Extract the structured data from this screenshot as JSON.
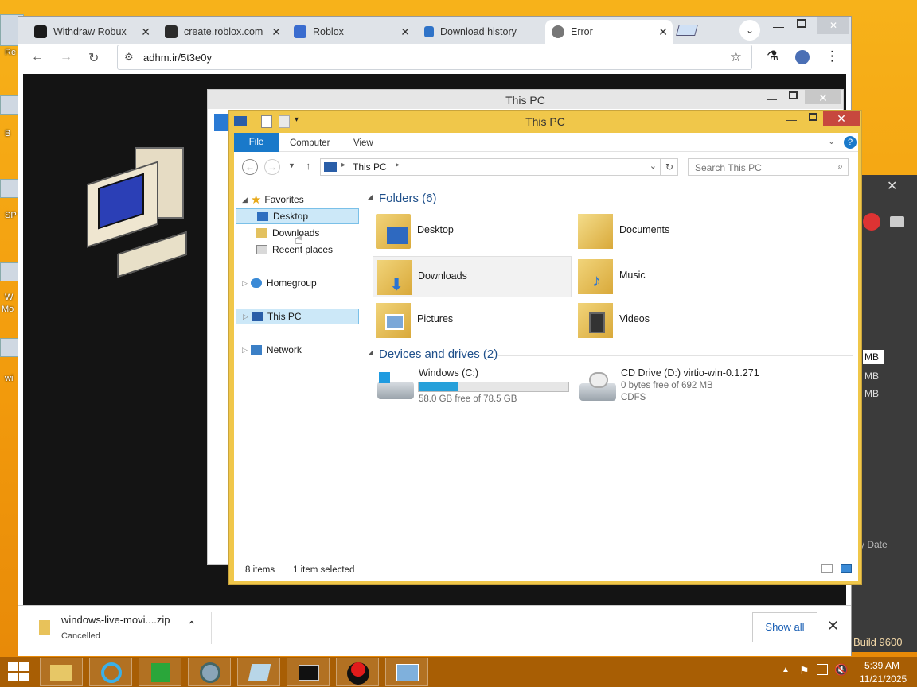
{
  "browser": {
    "tabs": [
      {
        "label": "Withdraw Robux",
        "favcolor": "#1b1b1b"
      },
      {
        "label": "create.roblox.com",
        "favcolor": "#2b2b2b"
      },
      {
        "label": "Roblox",
        "favcolor": "#3a6ccf"
      },
      {
        "label": "Download history",
        "favcolor": "#2f73c8"
      },
      {
        "label": "Error",
        "favcolor": "#666"
      }
    ],
    "url": "adhm.ir/5t3e0y",
    "download": {
      "filename": "windows-live-movi....zip",
      "status": "Cancelled",
      "show_all": "Show all"
    }
  },
  "explorer": {
    "title": "This PC",
    "back_title": "This PC",
    "ribbon": [
      "File",
      "Computer",
      "View"
    ],
    "breadcrumb": "This PC",
    "search_placeholder": "Search This PC",
    "nav": {
      "favorites": "Favorites",
      "desktop": "Desktop",
      "downloads": "Downloads",
      "recent": "Recent places",
      "homegroup": "Homegroup",
      "thispc": "This PC",
      "network": "Network"
    },
    "folders_header": "Folders (6)",
    "folders": [
      "Desktop",
      "Documents",
      "Downloads",
      "Music",
      "Pictures",
      "Videos"
    ],
    "devices_header": "Devices and drives (2)",
    "drives": [
      {
        "name": "Windows (C:)",
        "free": "58.0 GB free of 78.5 GB",
        "used_fraction": 0.26
      },
      {
        "name": "CD Drive (D:) virtio-win-0.1.271",
        "free": "0 bytes free of 692 MB",
        "fs": "CDFS"
      }
    ],
    "status_items": "8 items",
    "status_selected": "1 item selected"
  },
  "right_panel": {
    "sizes": [
      "MB",
      "MB",
      "MB"
    ],
    "sort": "y Date",
    "build": "Build 9600"
  },
  "taskbar": {
    "time": "5:39 AM",
    "date": "11/21/2025"
  },
  "desktop_labels": [
    "Re",
    "B",
    "SP",
    "W",
    "Mo",
    "wi"
  ]
}
